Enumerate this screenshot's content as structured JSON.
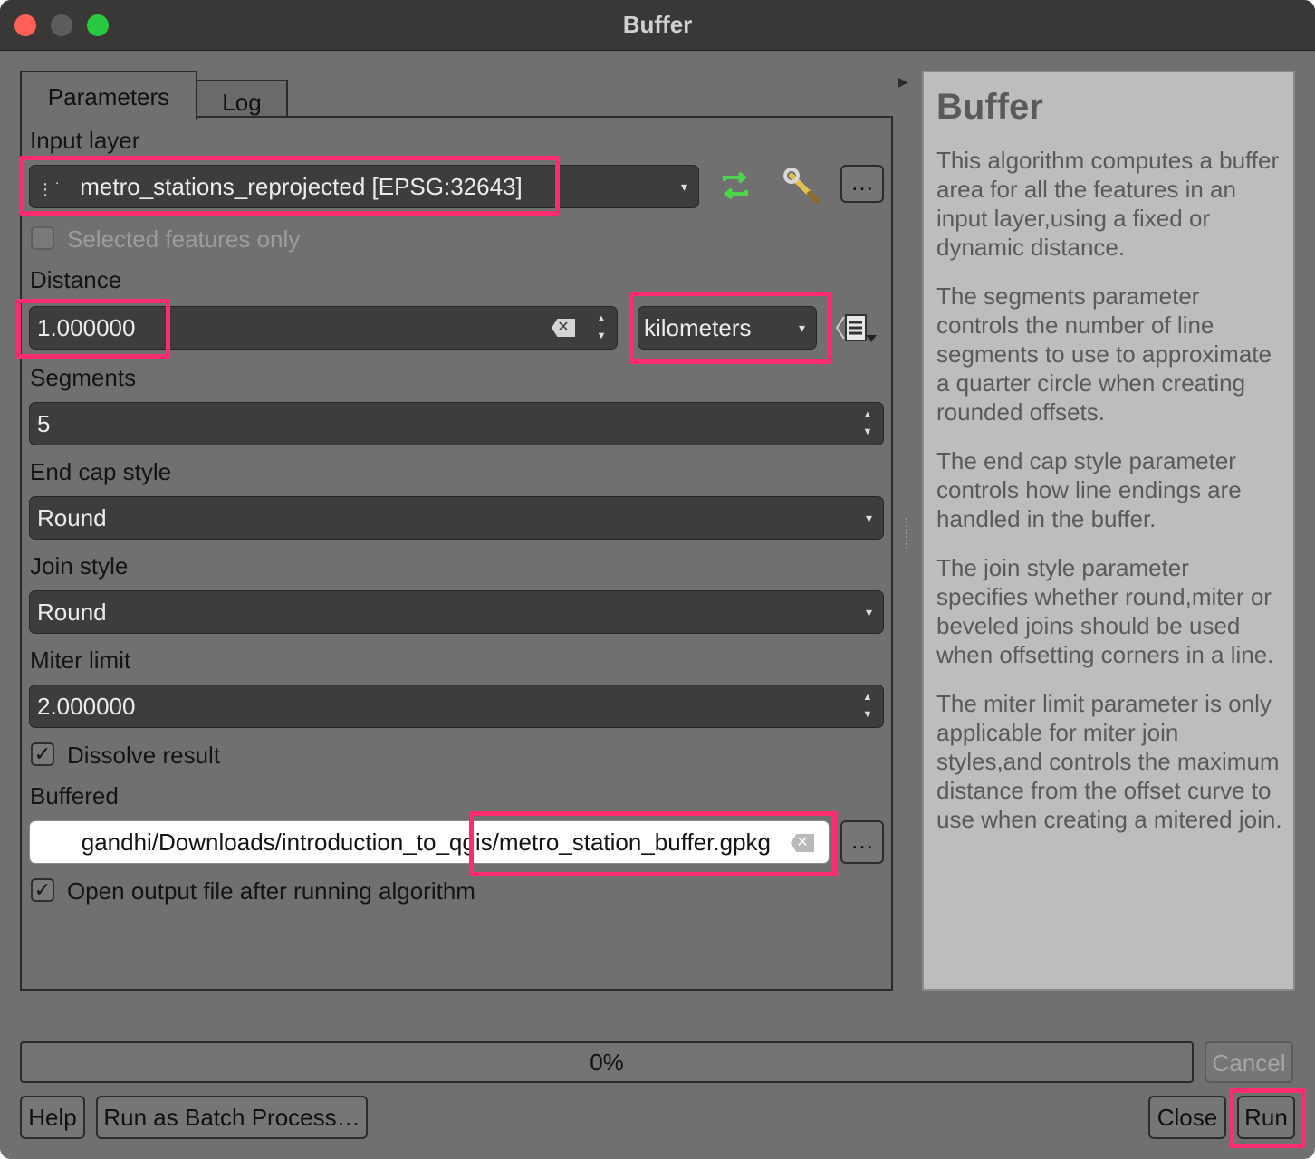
{
  "window": {
    "title": "Buffer"
  },
  "tabs": [
    {
      "label": "Parameters"
    },
    {
      "label": "Log"
    }
  ],
  "params": {
    "input_layer": {
      "label": "Input layer",
      "value": "metro_stations_reprojected [EPSG:32643]"
    },
    "selected_only": {
      "label": "Selected features only",
      "checked": false
    },
    "distance": {
      "label": "Distance",
      "value": "1.000000",
      "unit": "kilometers"
    },
    "segments": {
      "label": "Segments",
      "value": "5"
    },
    "end_cap": {
      "label": "End cap style",
      "value": "Round"
    },
    "join_style": {
      "label": "Join style",
      "value": "Round"
    },
    "miter": {
      "label": "Miter limit",
      "value": "2.000000"
    },
    "dissolve": {
      "label": "Dissolve result",
      "checked": true
    },
    "buffered": {
      "label": "Buffered",
      "value": "gandhi/Downloads/introduction_to_qgis/metro_station_buffer.gpkg"
    },
    "open_output": {
      "label": "Open output file after running algorithm",
      "checked": true
    }
  },
  "help": {
    "title": "Buffer",
    "paragraphs": [
      "This algorithm computes a buffer area for all the features in an input layer,using a fixed or dynamic distance.",
      "The segments parameter controls the number of line segments to use to approximate a quarter circle when creating rounded offsets.",
      "The end cap style parameter controls how line endings are handled in the buffer.",
      "The join style parameter specifies whether round,miter or beveled joins should be used when offsetting corners in a line.",
      "The miter limit parameter is only applicable for miter join styles,and controls the maximum distance from the offset curve to use when creating a mitered join."
    ]
  },
  "progress": {
    "text": "0%",
    "value": 0
  },
  "buttons": {
    "more": "…",
    "cancel": "Cancel",
    "help": "Help",
    "batch": "Run as Batch Process…",
    "close": "Close",
    "run": "Run"
  },
  "colors": {
    "highlight": "#ff2d6f",
    "iterate_icon": "#4fd34f"
  }
}
